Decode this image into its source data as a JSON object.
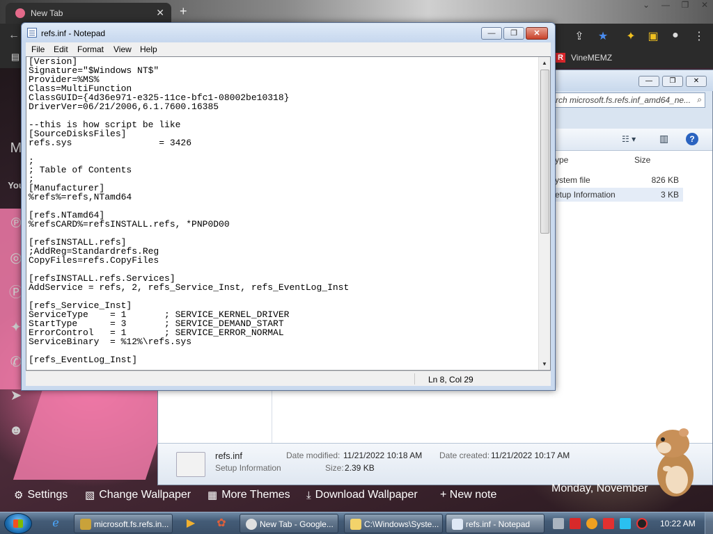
{
  "chrome": {
    "tab_title": "New Tab",
    "bookmark_vine": "VineMEMZ"
  },
  "explorer": {
    "search_placeholder": "rch microsoft.fs.refs.inf_amd64_ne...",
    "columns": {
      "type": "ype",
      "size": "Size"
    },
    "files": [
      {
        "type": "ystem file",
        "size": "826 KB"
      },
      {
        "type": "etup Information",
        "size": "3 KB"
      }
    ],
    "details": {
      "name": "refs.inf",
      "kind": "Setup Information",
      "modified_label": "Date modified:",
      "modified_value": "11/21/2022 10:18 AM",
      "created_label": "Date created:",
      "created_value": "11/21/2022 10:17 AM",
      "size_label": "Size:",
      "size_value": "2.39 KB"
    }
  },
  "notepad": {
    "title": "refs.inf - Notepad",
    "menu": [
      "File",
      "Edit",
      "Format",
      "View",
      "Help"
    ],
    "lines": [
      "[Version]",
      "Signature=\"$Windows NT$\"",
      "Provider=%MS%",
      "Class=MultiFunction",
      "ClassGUID={4d36e971-e325-11ce-bfc1-08002be10318}",
      "DriverVer=06/21/2006,6.1.7600.16385",
      "",
      "--this is how script be like",
      "[SourceDisksFiles]",
      "refs.sys                = 3426",
      "",
      ";",
      "; Table of Contents",
      ";",
      "[Manufacturer]",
      "%refs%=refs,NTamd64",
      "",
      "[refs.NTamd64]",
      "%refsCARD%=refsINSTALL.refs, *PNP0D00",
      "",
      "[refsINSTALL.refs]",
      ";AddReg=Standardrefs.Reg",
      "CopyFiles=refs.CopyFiles",
      "",
      "[refsINSTALL.refs.Services]",
      "AddService = refs, 2, refs_Service_Inst, refs_EventLog_Inst",
      "",
      "[refs_Service_Inst]",
      "ServiceType    = 1       ; SERVICE_KERNEL_DRIVER",
      "StartType      = 3       ; SERVICE_DEMAND_START",
      "ErrorControl   = 1       ; SERVICE_ERROR_NORMAL",
      "ServiceBinary  = %12%\\refs.sys",
      "",
      "[refs_EventLog_Inst]"
    ],
    "status": "Ln 8, Col 29"
  },
  "wallpaper_app": {
    "settings": "Settings",
    "change": "Change Wallpaper",
    "themes": "More Themes",
    "download": "Download Wallpaper",
    "new_note": "+ New note",
    "date": "Monday, November"
  },
  "taskbar": {
    "tasks": [
      {
        "label": "microsoft.fs.refs.in...",
        "color": "#c9a23a"
      },
      {
        "label": "New Tab - Google...",
        "color": "#e0e0e0"
      },
      {
        "label": "C:\\Windows\\Syste...",
        "color": "#f3d36a"
      },
      {
        "label": "refs.inf - Notepad",
        "color": "#dfe8f5"
      }
    ],
    "clock": "10:22 AM"
  },
  "colors": {
    "notepad_frame": "#c9d9ee",
    "taskbar": "#445c77",
    "close_button": "#c8412a"
  }
}
